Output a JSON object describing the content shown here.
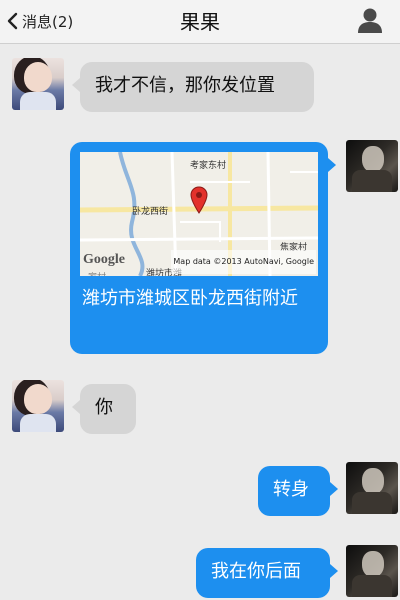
{
  "header": {
    "back_label": "消息(2)",
    "title": "果果",
    "profile_icon": "person-icon"
  },
  "messages": [
    {
      "from": "contact",
      "text": "我才不信，那你发位置"
    },
    {
      "from": "me",
      "type": "location",
      "map": {
        "labels": [
          "考家东村",
          "卧龙西街",
          "焦家村",
          "潍坊市潍",
          "家村"
        ],
        "brand": "Google",
        "copyright": "Map data ©2013 AutoNavi, Google"
      },
      "text": "潍坊市潍城区卧龙西街附近"
    },
    {
      "from": "contact",
      "text": "你"
    },
    {
      "from": "me",
      "text": "转身"
    },
    {
      "from": "me",
      "text": "我在你后面"
    }
  ],
  "colors": {
    "background": "#ebebeb",
    "outgoing_bubble": "#1d8fef",
    "incoming_bubble": "#d5d5d5",
    "pin": "#e3312b"
  }
}
